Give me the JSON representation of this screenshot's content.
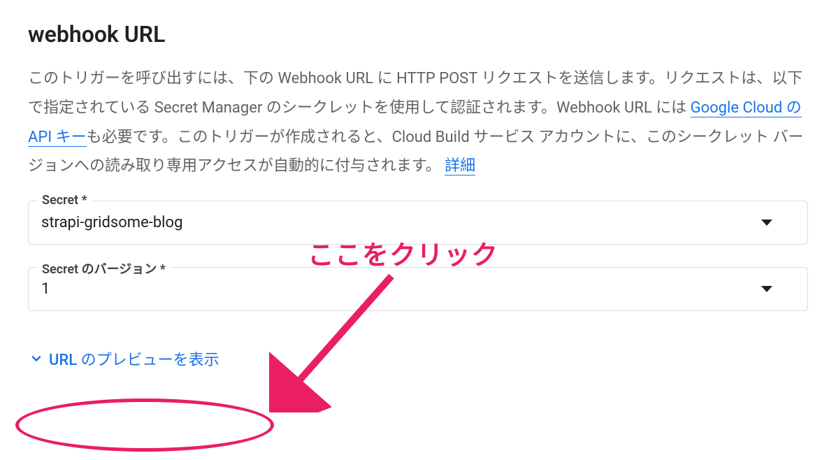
{
  "section": {
    "title": "webhook URL",
    "description_parts": {
      "p1": "このトリガーを呼び出すには、下の Webhook URL に HTTP POST リクエストを送信します。リクエストは、以下で指定されている Secret Manager のシークレットを使用して認証されます。Webhook URL には ",
      "link1": "Google Cloud の API キー",
      "p2": "も必要です。このトリガーが作成されると、Cloud Build サービス アカウントに、このシークレット バージョンへの読み取り専用アクセスが自動的に付与されます。 ",
      "link2": "詳細"
    }
  },
  "fields": {
    "secret": {
      "label": "Secret *",
      "value": "strapi-gridsome-blog"
    },
    "secret_version": {
      "label": "Secret のバージョン *",
      "value": "1"
    }
  },
  "expand": {
    "label": "URL のプレビューを表示"
  },
  "annotation": {
    "text": "ここをクリック"
  }
}
